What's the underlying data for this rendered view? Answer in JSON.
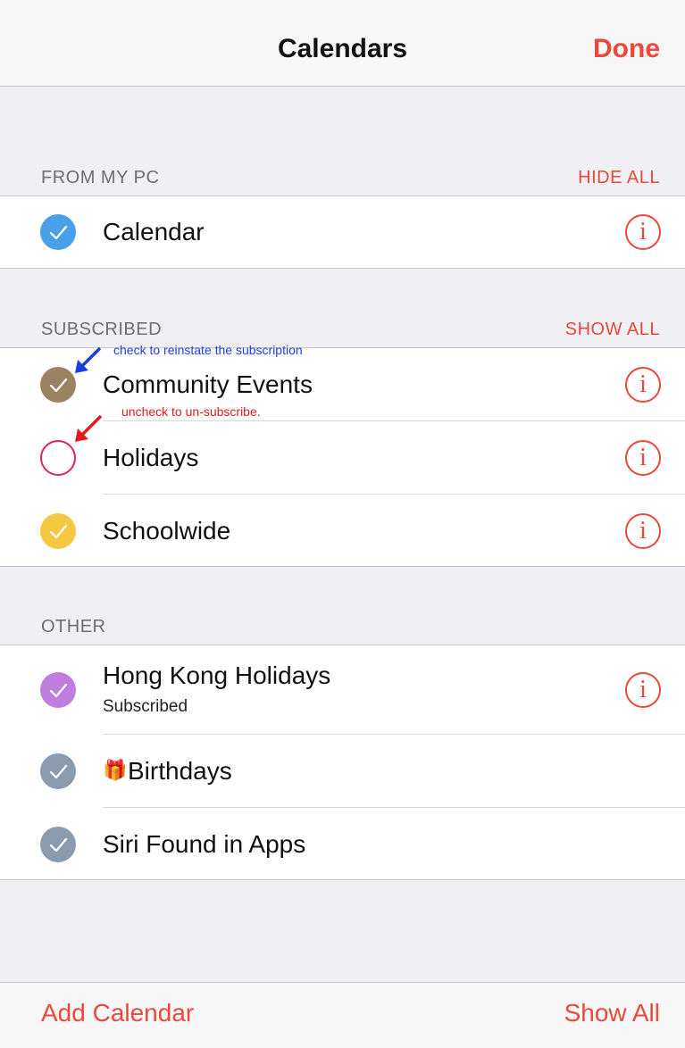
{
  "header": {
    "title": "Calendars",
    "done_label": "Done"
  },
  "sections": {
    "from_my_pc": {
      "title": "FROM MY PC",
      "action": "HIDE ALL",
      "items": [
        {
          "label": "Calendar",
          "checked": true,
          "color": "#4aa0e8"
        }
      ]
    },
    "subscribed": {
      "title": "SUBSCRIBED",
      "action": "SHOW ALL",
      "items": [
        {
          "label": "Community Events",
          "checked": true,
          "color": "#9b8263"
        },
        {
          "label": "Holidays",
          "checked": false,
          "color": "#e0245e"
        },
        {
          "label": "Schoolwide",
          "checked": true,
          "color": "#f5c842"
        }
      ]
    },
    "other": {
      "title": "OTHER",
      "items": [
        {
          "label": "Hong Kong Holidays",
          "sublabel": "Subscribed",
          "checked": true,
          "color": "#c07de0"
        },
        {
          "label": "Birthdays",
          "checked": true,
          "color": "#8a9bb0",
          "icon": "gift-icon"
        },
        {
          "label": "Siri Found in Apps",
          "checked": true,
          "color": "#8a9bb0"
        }
      ]
    }
  },
  "annotations": {
    "reinstate": "check to reinstate the subscription",
    "unsubscribe": "uncheck to un-subscribe."
  },
  "info_glyph": "i",
  "gift_glyph": "🎁",
  "footer": {
    "add_label": "Add Calendar",
    "show_label": "Show All"
  },
  "colors": {
    "accent": "#e8493a",
    "annotation_blue": "#1a3fe0",
    "annotation_red": "#e01b1b"
  }
}
